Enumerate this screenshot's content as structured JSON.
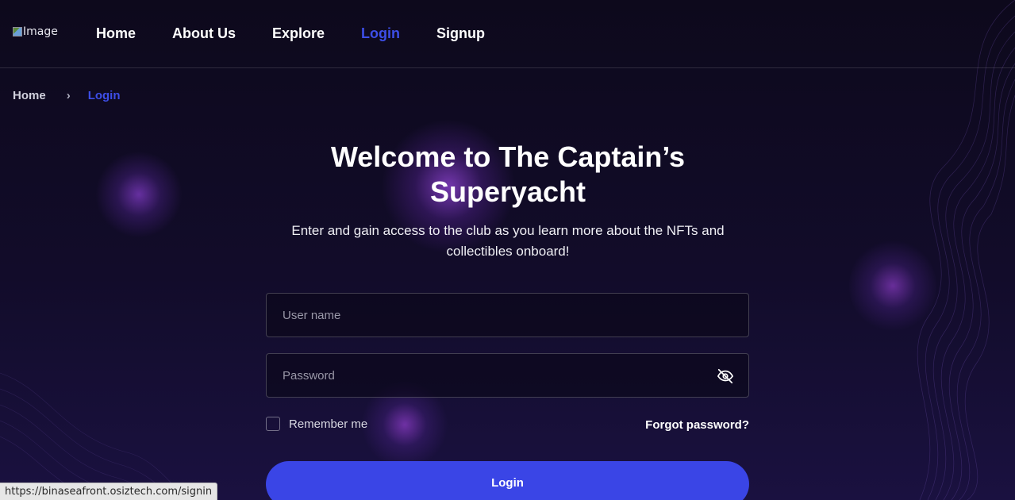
{
  "header": {
    "logo_alt": "Image",
    "nav": [
      {
        "label": "Home"
      },
      {
        "label": "About Us"
      },
      {
        "label": "Explore"
      },
      {
        "label": "Login",
        "active": true
      },
      {
        "label": "Signup"
      }
    ]
  },
  "breadcrumb": {
    "home": "Home",
    "separator": "›",
    "current": "Login"
  },
  "main": {
    "title": "Welcome to The Captain’s Superyacht",
    "subtitle": "Enter and gain access to the club as you learn more about the NFTs and collectibles onboard!",
    "username_placeholder": "User name",
    "username_value": "",
    "password_placeholder": "Password",
    "password_value": "",
    "password_toggle_icon": "eye-off-icon",
    "remember_label": "Remember me",
    "remember_checked": false,
    "forgot_label": "Forgot password?",
    "login_button": "Login"
  },
  "status_bar": {
    "url": "https://binaseafront.osiztech.com/signin"
  },
  "colors": {
    "accent": "#3d4ee8",
    "button": "#3a45e6",
    "background": "#0e0a1f"
  }
}
